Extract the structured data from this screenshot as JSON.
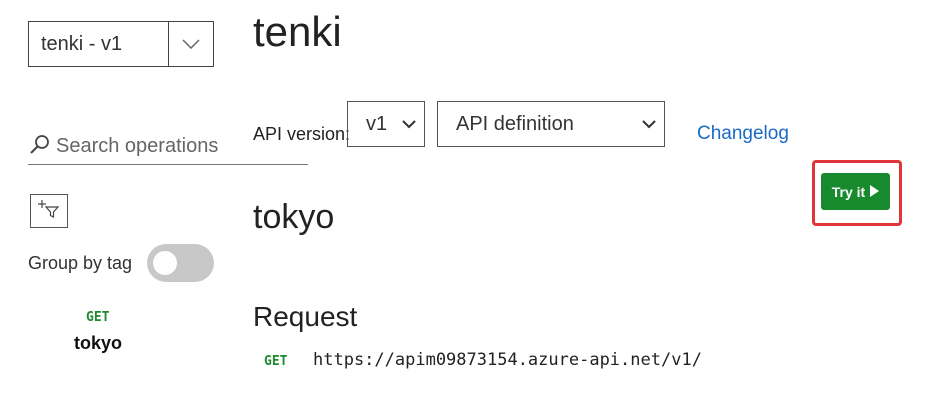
{
  "sidebar": {
    "api_selector": {
      "value": "tenki - v1"
    },
    "search": {
      "placeholder": "Search operations"
    },
    "group_by_tag": {
      "label": "Group by tag",
      "enabled": false
    },
    "operations": [
      {
        "method": "GET",
        "name": "tokyo"
      }
    ]
  },
  "main": {
    "title": "tenki",
    "api_version_label": "API version:",
    "version_select": {
      "value": "v1"
    },
    "definition_select": {
      "value": "API definition"
    },
    "changelog_label": "Changelog",
    "try_it_label": "Try it",
    "operation_title": "tokyo",
    "request_heading": "Request",
    "request": {
      "method": "GET",
      "url": "https://apim09873154.azure-api.net/v1/"
    }
  },
  "colors": {
    "accent_green": "#178a2e",
    "highlight_red": "#e0353a",
    "link_blue": "#1a6ac6",
    "toggle_off": "#c8c8c8"
  },
  "icons": [
    "chevron-down-icon",
    "search-icon",
    "filter-add-icon",
    "play-triangle-icon"
  ]
}
